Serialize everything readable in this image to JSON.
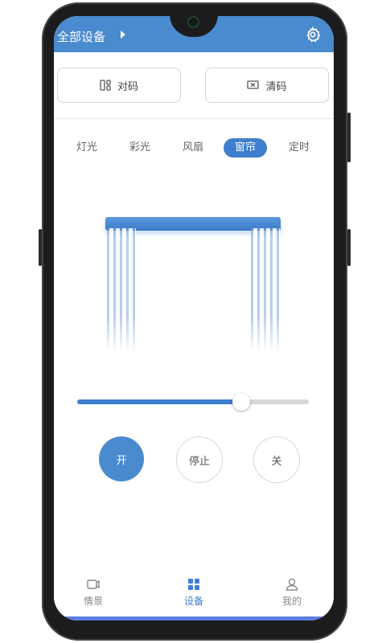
{
  "header": {
    "title": "全部设备"
  },
  "actions": {
    "pair_label": "对码",
    "clear_label": "清码"
  },
  "tabs": [
    {
      "label": "灯光",
      "active": false
    },
    {
      "label": "彩光",
      "active": false
    },
    {
      "label": "风扇",
      "active": false
    },
    {
      "label": "窗帘",
      "active": true
    },
    {
      "label": "定时",
      "active": false
    }
  ],
  "slider": {
    "value_percent": 71
  },
  "controls": {
    "open_label": "开",
    "stop_label": "停止",
    "close_label": "关"
  },
  "nav": [
    {
      "label": "情景",
      "icon": "scene-icon",
      "active": false
    },
    {
      "label": "设备",
      "icon": "grid-icon",
      "active": true
    },
    {
      "label": "我的",
      "icon": "user-icon",
      "active": false
    }
  ],
  "colors": {
    "accent": "#3e7fd0",
    "header": "#4a8bd0"
  }
}
